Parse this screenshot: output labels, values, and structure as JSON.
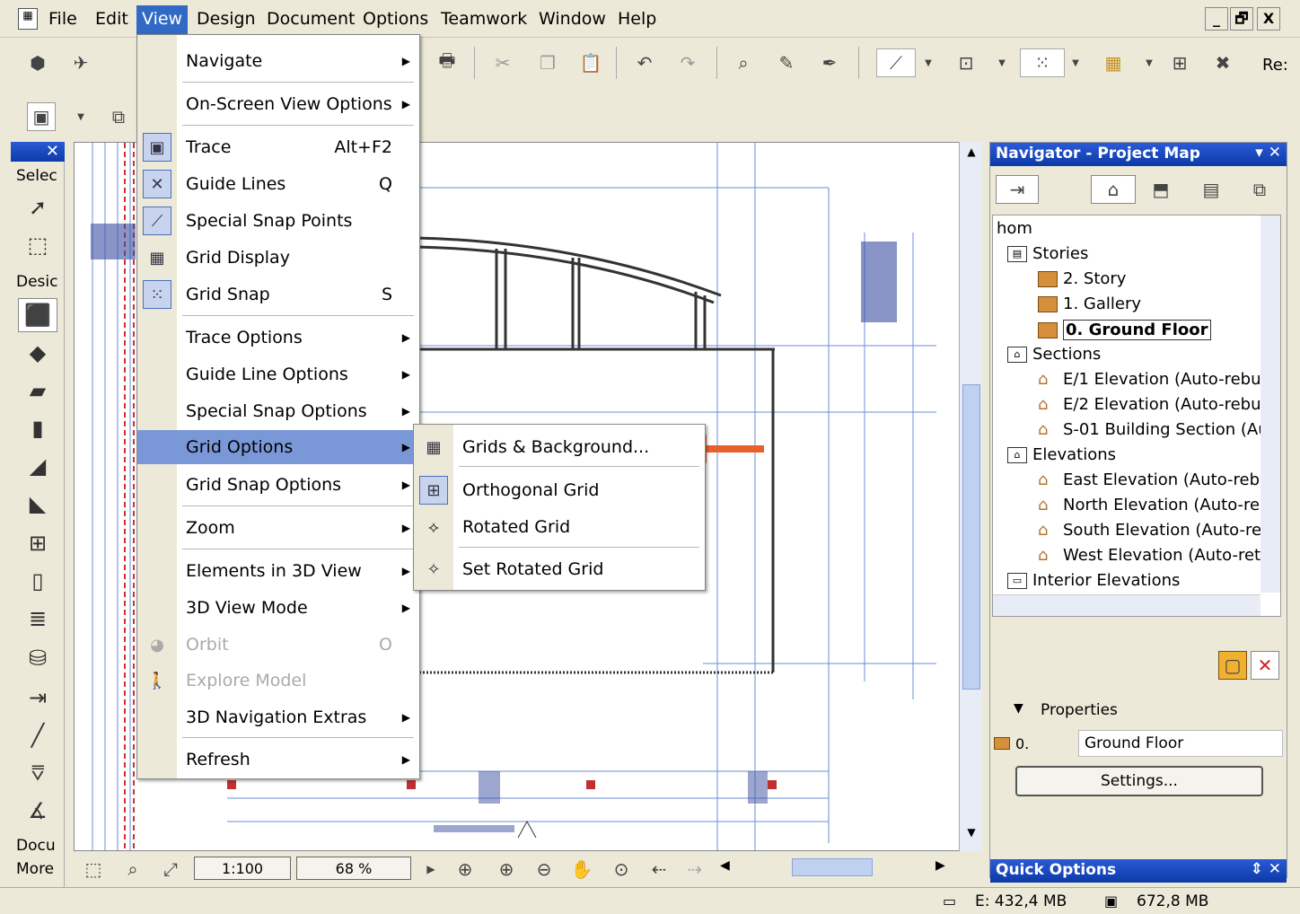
{
  "menubar": {
    "items": [
      "File",
      "Edit",
      "View",
      "Design",
      "Document",
      "Options",
      "Teamwork",
      "Window",
      "Help"
    ],
    "active": "View",
    "window_buttons": [
      "_",
      "🗗",
      "X"
    ]
  },
  "toolbar": {
    "res_label": "Re:"
  },
  "toolbox": {
    "select_label": "Selec",
    "design_label": "Desic",
    "docu_label": "Docu",
    "more_label": "More"
  },
  "view_menu": {
    "items": [
      {
        "label": "Navigate",
        "submenu": true
      },
      {
        "label": "On-Screen View Options",
        "submenu": true
      },
      {
        "label": "Trace",
        "shortcut": "Alt+F2"
      },
      {
        "label": "Guide Lines",
        "shortcut": "Q"
      },
      {
        "label": "Special Snap Points"
      },
      {
        "label": "Grid Display"
      },
      {
        "label": "Grid Snap",
        "shortcut": "S"
      },
      {
        "label": "Trace Options",
        "submenu": true
      },
      {
        "label": "Guide Line Options",
        "submenu": true
      },
      {
        "label": "Special Snap Options",
        "submenu": true
      },
      {
        "label": "Grid Options",
        "submenu": true
      },
      {
        "label": "Grid Snap Options",
        "submenu": true
      },
      {
        "label": "Zoom",
        "submenu": true
      },
      {
        "label": "Elements in 3D View",
        "submenu": true
      },
      {
        "label": "3D View Mode",
        "submenu": true
      },
      {
        "label": "Orbit",
        "shortcut": "O"
      },
      {
        "label": "Explore Model"
      },
      {
        "label": "3D Navigation Extras",
        "submenu": true
      },
      {
        "label": "Refresh",
        "submenu": true
      }
    ]
  },
  "grid_submenu": {
    "items": [
      "Grids & Background...",
      "Orthogonal Grid",
      "Rotated Grid",
      "Set Rotated Grid"
    ]
  },
  "navigator": {
    "title": "Navigator - Project Map",
    "tree": [
      {
        "label": "hom"
      },
      {
        "label": "Stories"
      },
      {
        "label": "2. Story"
      },
      {
        "label": "1. Gallery"
      },
      {
        "label": "0. Ground Floor"
      },
      {
        "label": "Sections"
      },
      {
        "label": "E/1 Elevation (Auto-rebu"
      },
      {
        "label": "E/2 Elevation (Auto-rebu"
      },
      {
        "label": "S-01 Building Section (Au"
      },
      {
        "label": "Elevations"
      },
      {
        "label": "East Elevation (Auto-reb"
      },
      {
        "label": "North Elevation (Auto-re"
      },
      {
        "label": "South Elevation (Auto-re"
      },
      {
        "label": "West Elevation (Auto-ret"
      },
      {
        "label": "Interior Elevations"
      }
    ],
    "properties_label": "Properties",
    "prop_id": "0.",
    "prop_name": "Ground Floor",
    "settings_button": "Settings...",
    "quick_options": "Quick Options"
  },
  "zoombar": {
    "scale": "1:100",
    "zoom": "68 %"
  },
  "status": {
    "disk": "E: 432,4 MB",
    "mem": "672,8 MB"
  },
  "colors": {
    "accent": "#316ac5",
    "selected_item": "#7a98d8",
    "arrow": "#e8602a"
  }
}
